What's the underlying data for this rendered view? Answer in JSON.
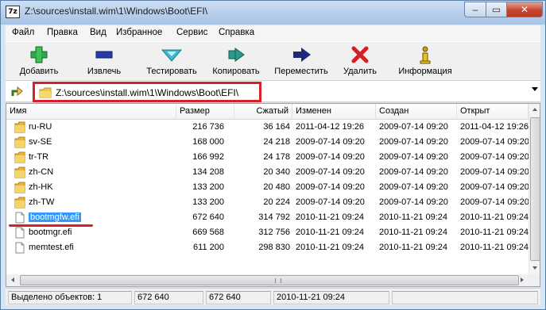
{
  "window": {
    "title": "Z:\\sources\\install.wim\\1\\Windows\\Boot\\EFI\\",
    "app_icon_text": "7z",
    "minimize_symbol": "‒",
    "maximize_symbol": "▭",
    "close_symbol": "✕"
  },
  "menu": [
    "Файл",
    "Правка",
    "Вид",
    "Избранное",
    "Сервис",
    "Справка"
  ],
  "toolbar": [
    {
      "label": "Добавить",
      "icon": "add-icon",
      "color": "#2ea84a"
    },
    {
      "label": "Извлечь",
      "icon": "extract-icon",
      "color": "#2a3aa8"
    },
    {
      "label": "Тестировать",
      "icon": "test-icon",
      "color": "#3fb8c8"
    },
    {
      "label": "Копировать",
      "icon": "copy-icon",
      "color": "#2a9a8a"
    },
    {
      "label": "Переместить",
      "icon": "move-icon",
      "color": "#1b2a7a"
    },
    {
      "label": "Удалить",
      "icon": "delete-icon",
      "color": "#d42020"
    },
    {
      "label": "Информация",
      "icon": "info-icon",
      "color": "#c8a010"
    }
  ],
  "address": {
    "path": "Z:\\sources\\install.wim\\1\\Windows\\Boot\\EFI\\"
  },
  "columns": [
    "Имя",
    "Размер",
    "Сжатый",
    "Изменен",
    "Создан",
    "Открыт"
  ],
  "files": [
    {
      "name": "ru-RU",
      "type": "folder",
      "size": "216 736",
      "packed": "36 164",
      "modified": "2011-04-12 19:26",
      "created": "2009-07-14 09:20",
      "accessed": "2011-04-12 19:26"
    },
    {
      "name": "sv-SE",
      "type": "folder",
      "size": "168 000",
      "packed": "24 218",
      "modified": "2009-07-14 09:20",
      "created": "2009-07-14 09:20",
      "accessed": "2009-07-14 09:20"
    },
    {
      "name": "tr-TR",
      "type": "folder",
      "size": "166 992",
      "packed": "24 178",
      "modified": "2009-07-14 09:20",
      "created": "2009-07-14 09:20",
      "accessed": "2009-07-14 09:20"
    },
    {
      "name": "zh-CN",
      "type": "folder",
      "size": "134 208",
      "packed": "20 340",
      "modified": "2009-07-14 09:20",
      "created": "2009-07-14 09:20",
      "accessed": "2009-07-14 09:20"
    },
    {
      "name": "zh-HK",
      "type": "folder",
      "size": "133 200",
      "packed": "20 480",
      "modified": "2009-07-14 09:20",
      "created": "2009-07-14 09:20",
      "accessed": "2009-07-14 09:20"
    },
    {
      "name": "zh-TW",
      "type": "folder",
      "size": "133 200",
      "packed": "20 224",
      "modified": "2009-07-14 09:20",
      "created": "2009-07-14 09:20",
      "accessed": "2009-07-14 09:20"
    },
    {
      "name": "bootmgfw.efi",
      "type": "file",
      "selected": true,
      "size": "672 640",
      "packed": "314 792",
      "modified": "2010-11-21 09:24",
      "created": "2010-11-21 09:24",
      "accessed": "2010-11-21 09:24"
    },
    {
      "name": "bootmgr.efi",
      "type": "file",
      "size": "669 568",
      "packed": "312 756",
      "modified": "2010-11-21 09:24",
      "created": "2010-11-21 09:24",
      "accessed": "2010-11-21 09:24"
    },
    {
      "name": "memtest.efi",
      "type": "file",
      "size": "611 200",
      "packed": "298 830",
      "modified": "2010-11-21 09:24",
      "created": "2010-11-21 09:24",
      "accessed": "2010-11-21 09:24"
    }
  ],
  "status": {
    "selected": "Выделено объектов: 1",
    "size": "672 640",
    "packed": "672 640",
    "modified": "2010-11-21 09:24"
  },
  "colors": {
    "highlight_red": "#d9202a",
    "selection_blue": "#3399ff",
    "folder_yellow": "#f2c94c"
  }
}
